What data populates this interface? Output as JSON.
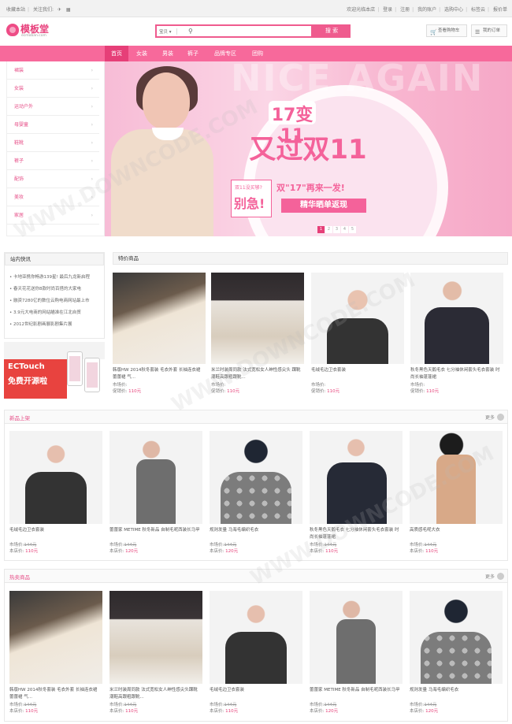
{
  "topbar": {
    "left": [
      "收藏本站",
      "关注我们:"
    ],
    "right": [
      "欢迎光临本店",
      "登录",
      "注册",
      "我的账户",
      "选购中心",
      "标签云",
      "报价单"
    ]
  },
  "header": {
    "logo_text": "模板堂",
    "logo_sub": "ecmoban.com",
    "search_select": "宝贝",
    "search_placeholder": "",
    "search_button": "搜 索",
    "cart_button": "查看购物车",
    "orders_button": "我的订单"
  },
  "nav": [
    "首页",
    "女装",
    "男装",
    "裤子",
    "品牌专区",
    "团购"
  ],
  "categories": [
    "裙装",
    "女装",
    "运动户外",
    "母婴童",
    "鞋靴",
    "裤子",
    "配饰",
    "美妆",
    "家居"
  ],
  "banner": {
    "bg_text": "NICE AGAIN",
    "t1": "17变11",
    "t2": "又过双11",
    "t3a": "双11没买够?",
    "t3b": "别急!",
    "t4": "双\"17\"再来一发!",
    "t5": "精华晒单返现",
    "pages": [
      "1",
      "2",
      "3",
      "4",
      "5"
    ]
  },
  "news": {
    "title": "站内快讯",
    "items": [
      "卡地亚携你畅游139星! 最后九龙新启程",
      "春天花花送你8款时尚百搭的大家电",
      "融资7280亿的数位云购电商网站最上市",
      "3.9元大电商的网站瞄准在江北自贸",
      "2012世纪影剧画展影剧集片展"
    ]
  },
  "ad": {
    "t1": "ECTouch",
    "t2": "免费开源啦"
  },
  "labels": {
    "market": "市场价:",
    "promo": "促销价:",
    "shop": "本店价:",
    "more": "更多"
  },
  "special": {
    "title": "特价商品",
    "items": [
      {
        "title": "韩版HW 2014秋冬套装 毛衣外套 长袖连衣裙 蕾蕾裙 气...",
        "market": "",
        "price": "110元"
      },
      {
        "title": "米兰时装周同款 法式宽松女人绅性感尖头 踝靴 潮鞋高跟粗跟靴...",
        "market": "",
        "price": "110元"
      },
      {
        "title": "毛绒毛边卫衣套装",
        "market": "",
        "price": "110元"
      },
      {
        "title": "秋冬黑色天鹅毛衣 七分袖休闲套头毛衣套装 时尚长袖蓬蓬裙",
        "market": "",
        "price": "110元"
      }
    ]
  },
  "new_arrivals": {
    "title": "新品上架",
    "items": [
      {
        "title": "毛绒毛边卫衣套装",
        "market": "144元",
        "price": "110元"
      },
      {
        "title": "蕾蕾家 METIME 秋冬新品 自制毛呢西装长马甲",
        "market": "144元",
        "price": "120元"
      },
      {
        "title": "规则发量 马海毛编织毛衣",
        "market": "144元",
        "price": "120元"
      },
      {
        "title": "秋冬黑色天鹅毛衣 七分袖休闲套头毛衣套装 时尚长袖蓬蓬裙",
        "market": "144元",
        "price": "110元"
      },
      {
        "title": "高质感毛呢大衣",
        "market": "144元",
        "price": "110元"
      }
    ]
  },
  "hot": {
    "title": "热卖商品",
    "items": [
      {
        "title": "韩版HW 2014秋冬套装 毛衣外套 长袖连衣裙 蕾蕾裙 气...",
        "market": "144元",
        "price": "110元"
      },
      {
        "title": "米兰时装周同款 法式宽松女人绅性感尖头踝靴 潮鞋高跟粗跟靴...",
        "market": "144元",
        "price": "110元"
      },
      {
        "title": "毛绒毛边卫衣套装",
        "market": "144元",
        "price": "110元"
      },
      {
        "title": "蕾蕾家 METIME 秋冬新品 自制毛呢西装长马甲",
        "market": "144元",
        "price": "120元"
      },
      {
        "title": "规则发量 马海毛编织毛衣",
        "market": "144元",
        "price": "120元"
      }
    ]
  },
  "watermark": "WWW.DOWNCODE.COM"
}
